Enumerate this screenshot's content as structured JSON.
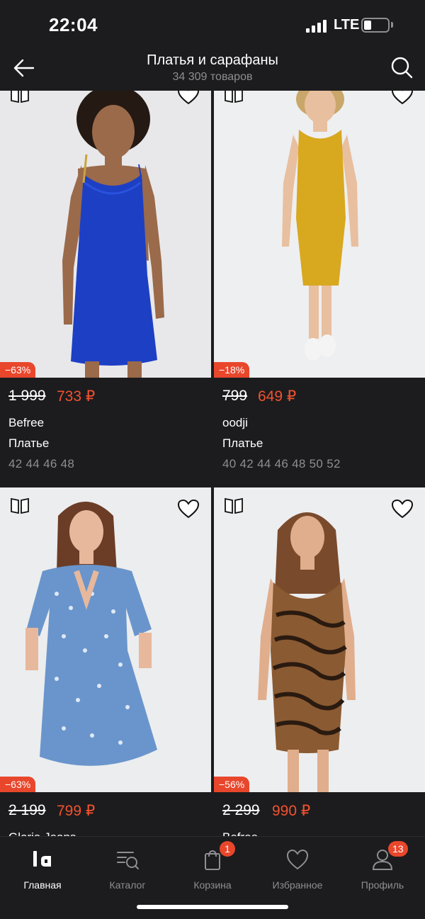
{
  "status": {
    "time": "22:04",
    "network": "LTE",
    "battery_level": 0.3
  },
  "header": {
    "title": "Платья и сарафаны",
    "count": "34 309 товаров"
  },
  "products": [
    {
      "discount": "−63%",
      "old_price": "1 999",
      "new_price": "733 ₽",
      "brand": "Befree",
      "type": "Платье",
      "sizes": "42 44 46 48"
    },
    {
      "discount": "−18%",
      "old_price": "799",
      "new_price": "649 ₽",
      "brand": "oodji",
      "type": "Платье",
      "sizes": "40 42 44 46 48 50 52"
    },
    {
      "discount": "−63%",
      "old_price": "2 199",
      "new_price": "799 ₽",
      "brand": "Gloria Jeans",
      "type": "",
      "sizes": ""
    },
    {
      "discount": "−56%",
      "old_price": "2 299",
      "new_price": "990 ₽",
      "brand": "Befree",
      "type": "",
      "sizes": ""
    }
  ],
  "tabs": [
    {
      "label": "Главная",
      "icon": "lamoda-logo-icon",
      "active": true
    },
    {
      "label": "Каталог",
      "icon": "catalog-search-icon"
    },
    {
      "label": "Корзина",
      "icon": "shopping-bag-icon",
      "badge": "1"
    },
    {
      "label": "Избранное",
      "icon": "heart-icon"
    },
    {
      "label": "Профиль",
      "icon": "profile-icon",
      "badge": "13"
    }
  ],
  "colors": {
    "background": "#1c1c1e",
    "accent": "#f2522e",
    "badge": "#e8472c",
    "muted": "#8e8e93"
  }
}
